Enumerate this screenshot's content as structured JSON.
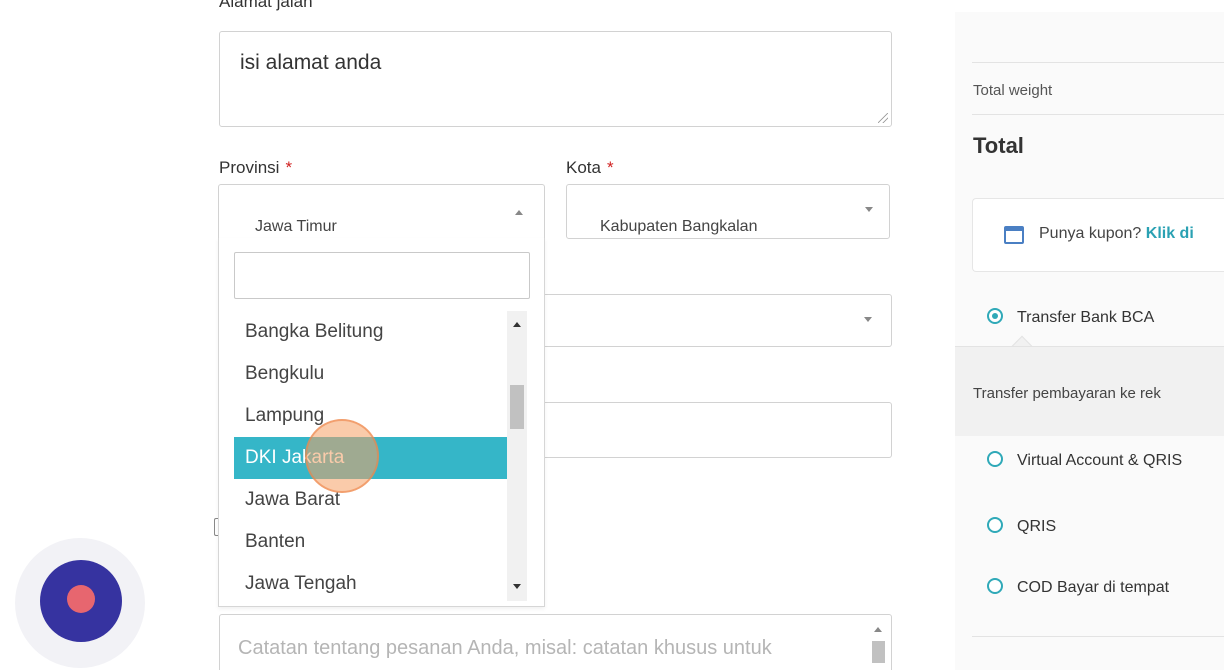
{
  "address": {
    "label": "Alamat jalan",
    "value": "isi alamat anda"
  },
  "province": {
    "label": "Provinsi",
    "required_mark": "*",
    "selected": "Jawa Timur",
    "search_value": "",
    "options": [
      "Bangka Belitung",
      "Bengkulu",
      "Lampung",
      "DKI Jakarta",
      "Jawa Barat",
      "Banten",
      "Jawa Tengah"
    ],
    "highlighted": "DKI Jakarta"
  },
  "city": {
    "label": "Kota",
    "required_mark": "*",
    "selected": "Kabupaten Bangkalan"
  },
  "notes": {
    "placeholder": "Catatan tentang pesanan Anda, misal: catatan khusus untuk"
  },
  "sidebar": {
    "total_weight_label": "Total weight",
    "total_label": "Total",
    "coupon_prompt": "Punya kupon?",
    "coupon_link": "Klik di",
    "payment_methods": [
      {
        "label": "Transfer Bank BCA",
        "checked": true
      },
      {
        "label": "Virtual Account & QRIS",
        "checked": false
      },
      {
        "label": "QRIS",
        "checked": false
      },
      {
        "label": "COD Bayar di tempat",
        "checked": false
      }
    ],
    "payment_description": "Transfer pembayaran ke rek"
  },
  "colors": {
    "accent": "#35b6c8",
    "required": "#d0201f",
    "recorder_ring": "#3633a0",
    "recorder_dot": "#e7666f"
  }
}
